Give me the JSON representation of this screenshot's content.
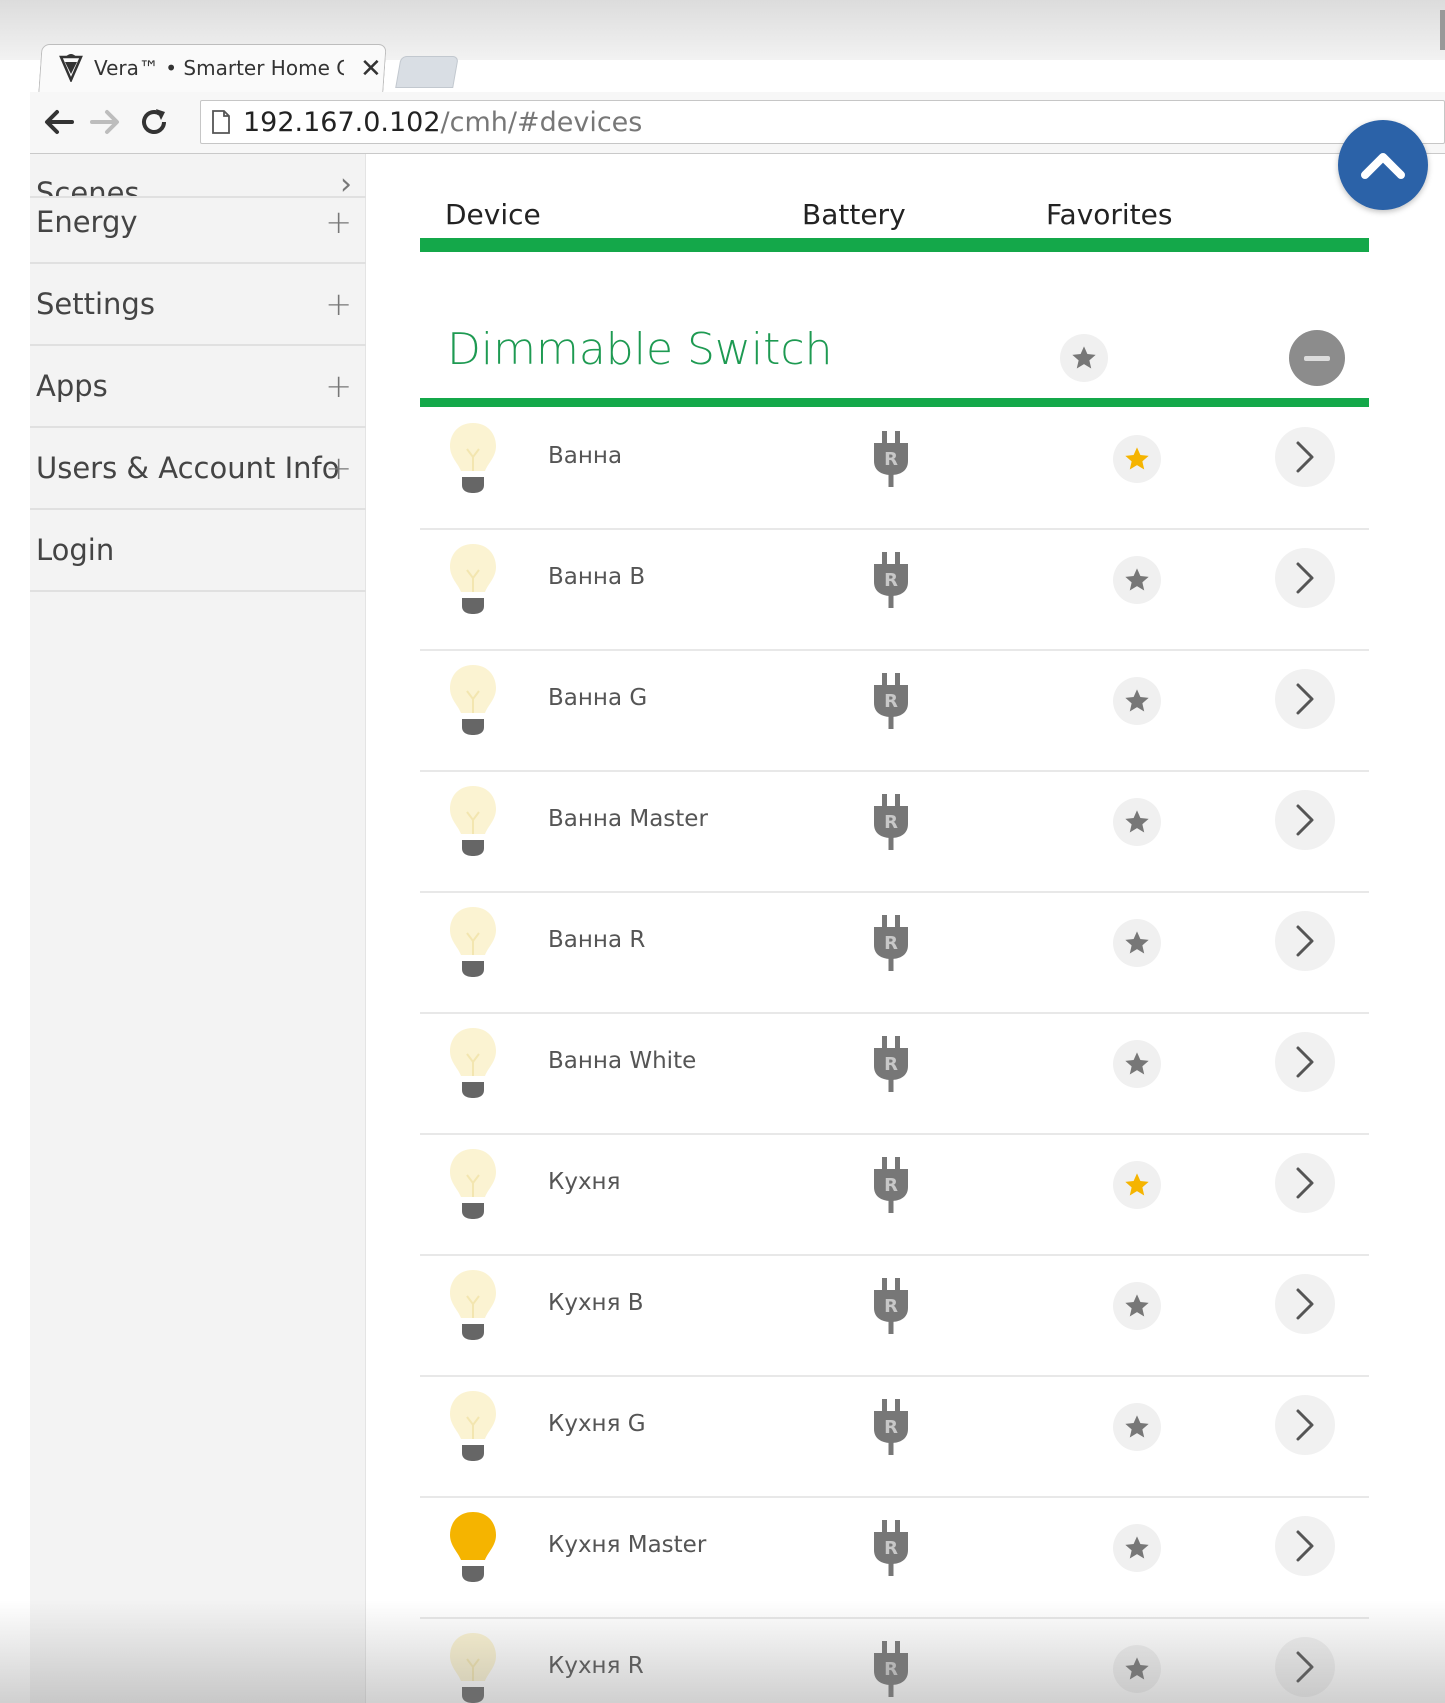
{
  "browser": {
    "tab_title": "Vera™  •  Smarter Home C",
    "tab_close": "✕",
    "url_host": "192.167.0.102",
    "url_path": "/cmh/#devices"
  },
  "sidebar": {
    "items": [
      {
        "label": "Scenes",
        "indicator": "›"
      },
      {
        "label": "Energy",
        "indicator": "+"
      },
      {
        "label": "Settings",
        "indicator": "+"
      },
      {
        "label": "Apps",
        "indicator": "+"
      },
      {
        "label": "Users & Account Info",
        "indicator": "+"
      },
      {
        "label": "Login",
        "indicator": ""
      }
    ]
  },
  "table": {
    "headers": {
      "device": "Device",
      "battery": "Battery",
      "favorites": "Favorites"
    },
    "section_title": "Dimmable Switch",
    "rows": [
      {
        "name": "Ванна",
        "favorite": true,
        "bulb_on": false
      },
      {
        "name": "Ванна B",
        "favorite": false,
        "bulb_on": false
      },
      {
        "name": "Ванна G",
        "favorite": false,
        "bulb_on": false
      },
      {
        "name": "Ванна Master",
        "favorite": false,
        "bulb_on": false
      },
      {
        "name": "Ванна R",
        "favorite": false,
        "bulb_on": false
      },
      {
        "name": "Ванна White",
        "favorite": false,
        "bulb_on": false
      },
      {
        "name": "Кухня",
        "favorite": true,
        "bulb_on": false
      },
      {
        "name": "Кухня B",
        "favorite": false,
        "bulb_on": false
      },
      {
        "name": "Кухня G",
        "favorite": false,
        "bulb_on": false
      },
      {
        "name": "Кухня Master",
        "favorite": false,
        "bulb_on": true
      },
      {
        "name": "Кухня R",
        "favorite": false,
        "bulb_on": false
      }
    ]
  },
  "colors": {
    "accent_green": "#14a84a",
    "title_green": "#1e9a52",
    "fab_blue": "#2b62a8",
    "star_on": "#f5b400",
    "star_off": "#777777",
    "bulb_on": "#f5b400",
    "bulb_off": "#fbf3d2"
  },
  "icons": {
    "vera": "vera-logo-icon",
    "back": "back-arrow-icon",
    "forward": "forward-arrow-icon",
    "reload": "reload-icon",
    "page": "page-icon",
    "bulb": "bulb-icon",
    "plug": "plug-icon",
    "star": "star-icon",
    "chevron": "chevron-right-icon",
    "collapse": "minus-icon",
    "scroll_top": "chevron-up-icon"
  }
}
